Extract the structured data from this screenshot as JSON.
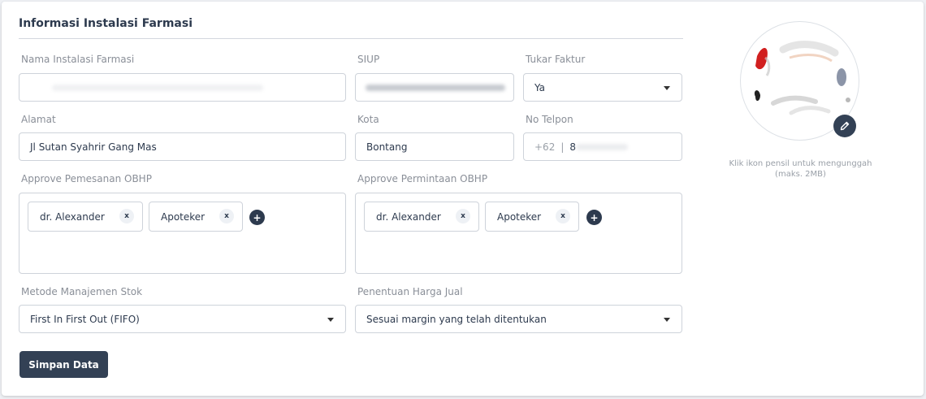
{
  "section": {
    "title": "Informasi Instalasi Farmasi"
  },
  "fields": {
    "nama": {
      "label": "Nama Instalasi Farmasi",
      "value": ""
    },
    "siup": {
      "label": "SIUP",
      "value": ""
    },
    "tukar_faktur": {
      "label": "Tukar Faktur",
      "value": "Ya"
    },
    "alamat": {
      "label": "Alamat",
      "value": "Jl Sutan Syahrir Gang Mas"
    },
    "kota": {
      "label": "Kota",
      "value": "Bontang"
    },
    "telpon": {
      "label": "No Telpon",
      "prefix": "+62",
      "separator": "|",
      "value": "8"
    }
  },
  "approve_pemesanan": {
    "label": "Approve Pemesanan OBHP",
    "chips": [
      "dr. Alexander",
      "Apoteker"
    ],
    "remove_glyph": "x",
    "add_glyph": "+"
  },
  "approve_permintaan": {
    "label": "Approve Permintaan OBHP",
    "chips": [
      "dr. Alexander",
      "Apoteker"
    ],
    "remove_glyph": "x",
    "add_glyph": "+"
  },
  "metode_stok": {
    "label": "Metode Manajemen Stok",
    "value": "First In First Out (FIFO)"
  },
  "harga_jual": {
    "label": "Penentuan Harga Jual",
    "value": "Sesuai margin yang telah ditentukan"
  },
  "actions": {
    "save_label": "Simpan Data"
  },
  "photo": {
    "hint": "Klik ikon pensil untuk mengunggah (maks. 2MB)"
  },
  "icons": {
    "edit": "pencil-icon",
    "dropdown": "chevron-down-icon",
    "add": "plus-icon",
    "remove": "close-icon"
  },
  "colors": {
    "primary": "#334155",
    "border": "#ced3da",
    "label": "#8a8f98",
    "text": "#2d3a4e"
  }
}
